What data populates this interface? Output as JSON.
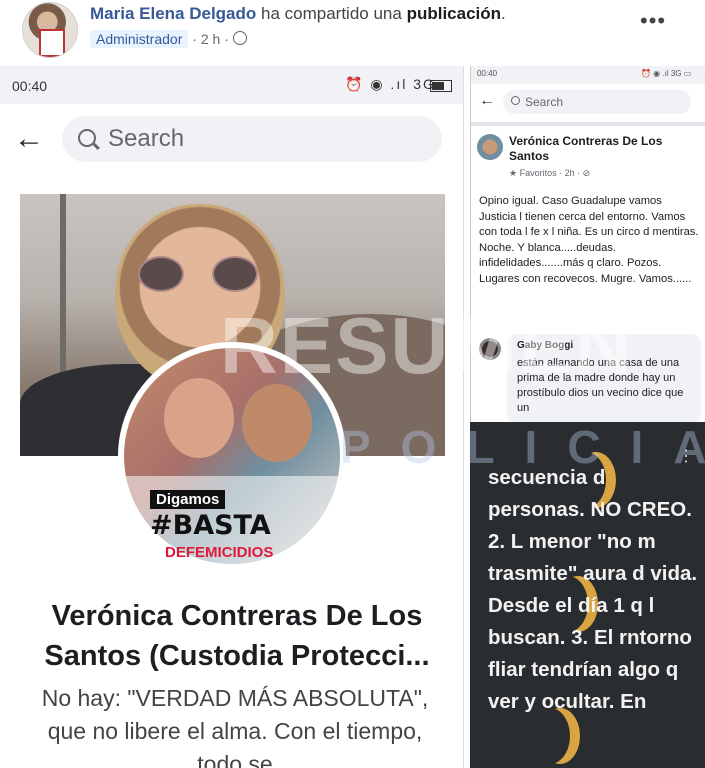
{
  "post_header": {
    "author": "Maria Elena Delgado",
    "action": "ha compartido una",
    "object": "publicación",
    "suffix": ".",
    "badge": "Administrador",
    "time": "2 h",
    "separator": "·",
    "more": "•••"
  },
  "left_screenshot": {
    "status_time": "00:40",
    "status_icons": "⏰ ◉ .ıl 3G",
    "back_arrow": "←",
    "search_placeholder": "Search",
    "frame": {
      "line1": "Digamos",
      "line2": "#BASTA",
      "line3": "DEFEMICIDIOS"
    },
    "page_name": "Verónica Contreras De Los Santos (Custodia Protecci...",
    "bio": "No hay: \"VERDAD MÁS ABSOLUTA\", que no libere el alma. Con el tiempo, todo se"
  },
  "right_top_screenshot": {
    "status_time": "00:40",
    "status_icons": "⏰ ◉ .ıl 3G ▭",
    "back_arrow": "←",
    "search_placeholder": "Search",
    "post_author": "Verónica Contreras De Los Santos",
    "post_meta": "★ Favoritos · 2h · ⊘",
    "post_body": "Opino igual. Caso Guadalupe vamos Justicia l tienen cerca del entorno. Vamos con toda l fe x l niña.  Es un circo d mentiras. Noche. Y blanca.....deudas. infidelidades.......más q claro. Pozos. Lugares con recovecos.  Mugre. Vamos......",
    "comment_author": "Gaby Boggi",
    "comment_text": "están allanando una casa de una prima de la madre donde hay un prostíbulo dios un vecino dice que un"
  },
  "right_bottom_screenshot": {
    "more": "⋮",
    "text": "secuencia d personas. NO CREO. 2. L menor \"no m trasmite\" aura d vida. Desde el día 1 q l buscan. 3. El rntorno fliar tendrían algo q ver y ocultar.  En"
  },
  "watermark": {
    "line1": "RESUMEN",
    "line2": "POLICIAL"
  },
  "colors": {
    "facebook_blue": "#385898",
    "badge_bg": "#e7f3ff",
    "dark_bg": "#2a2d30",
    "accent_red": "#e0193a"
  }
}
